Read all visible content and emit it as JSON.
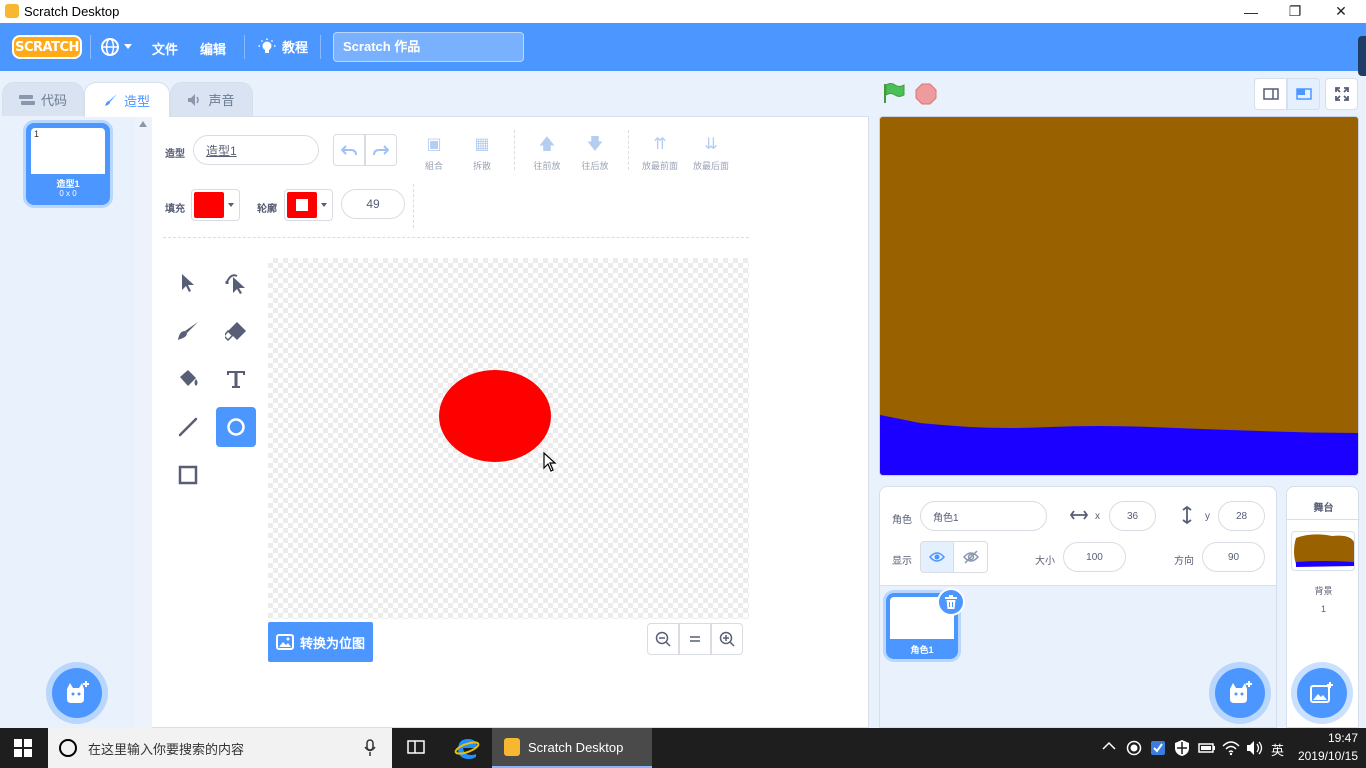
{
  "window": {
    "title": "Scratch Desktop"
  },
  "menubar": {
    "logo_text": "SCRATCH",
    "file": "文件",
    "edit": "编辑",
    "tutorial": "教程",
    "project_title": "Scratch 作品"
  },
  "tabs": [
    {
      "label": "代码"
    },
    {
      "label": "造型"
    },
    {
      "label": "声音"
    }
  ],
  "costumes": [
    {
      "number": "1",
      "name": "造型1",
      "size": "0 x 0"
    }
  ],
  "paint": {
    "costume_label": "造型",
    "costume_name": "造型1",
    "ops": {
      "group": "組合",
      "ungroup": "拆散",
      "forward": "往前放",
      "backward": "往后放",
      "front": "放最前面",
      "back": "放最后面"
    },
    "fill_label": "填充",
    "outline_label": "轮廓",
    "outline_width": "49",
    "fill_color": "#ff0000",
    "outline_color": "#ff0000",
    "convert_button": "转换为位图",
    "active_tool": "circle"
  },
  "sprite": {
    "label": "角色",
    "name": "角色1",
    "x_label": "x",
    "x": "36",
    "y_label": "y",
    "y": "28",
    "show_label": "显示",
    "size_label": "大小",
    "size": "100",
    "direction_label": "方向",
    "direction": "90"
  },
  "sprites": [
    {
      "name": "角色1"
    }
  ],
  "stage_panel": {
    "title": "舞台",
    "backdrop_label": "背景",
    "backdrop_count": "1"
  },
  "stage_colors": {
    "ground": "#996100",
    "water": "#1c00ff"
  },
  "taskbar": {
    "search_placeholder": "在这里输入你要搜索的内容",
    "app": "Scratch Desktop",
    "ime": "英",
    "time": "19:47",
    "date": "2019/10/15"
  }
}
